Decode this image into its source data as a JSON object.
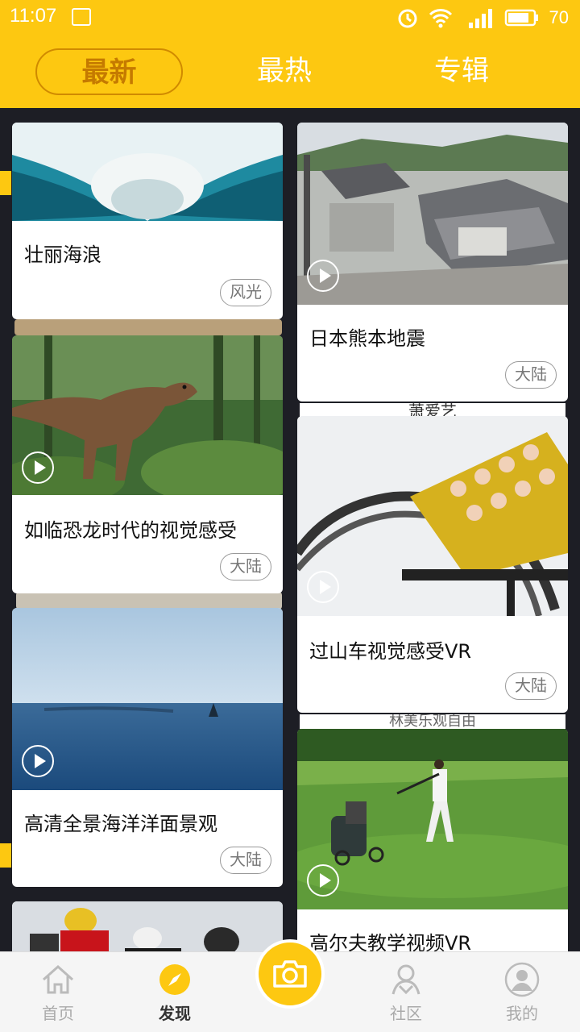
{
  "status_bar": {
    "time": "11:07",
    "battery": "70",
    "icons": [
      "notification-icon",
      "alarm-icon",
      "wifi-icon",
      "signal-4g-icon",
      "battery-icon"
    ]
  },
  "tabs": [
    {
      "label": "最新",
      "active": true
    },
    {
      "label": "最热",
      "active": false
    },
    {
      "label": "专辑",
      "active": false
    }
  ],
  "peek_texts": {
    "left_card": "",
    "behind_right_1": "萧爱艺",
    "behind_right_2": "林美乐观自由"
  },
  "cards": {
    "left": [
      {
        "title": "壮丽海浪",
        "tag": "风光",
        "video": false
      },
      {
        "title": "如临恐龙时代的视觉感受",
        "tag": "大陆",
        "video": true
      },
      {
        "title": "高清全景海洋洋面景观",
        "tag": "大陆",
        "video": true
      },
      {
        "title": "",
        "tag": "",
        "video": false
      }
    ],
    "right": [
      {
        "title": "日本熊本地震",
        "tag": "大陆",
        "video": true
      },
      {
        "title": "过山车视觉感受VR",
        "tag": "大陆",
        "video": true
      },
      {
        "title": "高尔夫教学视频VR",
        "tag": "",
        "video": true
      }
    ]
  },
  "bottom_nav": [
    {
      "label": "首页",
      "icon": "home-icon",
      "active": false
    },
    {
      "label": "发现",
      "icon": "compass-icon",
      "active": true
    },
    {
      "label": "",
      "icon": "camera-icon",
      "active": false
    },
    {
      "label": "社区",
      "icon": "community-icon",
      "active": false
    },
    {
      "label": "我的",
      "icon": "profile-icon",
      "active": false
    }
  ],
  "colors": {
    "brand_yellow": "#fdc811",
    "active_tab_text": "#c57a00",
    "feed_background": "#1d1e25"
  }
}
